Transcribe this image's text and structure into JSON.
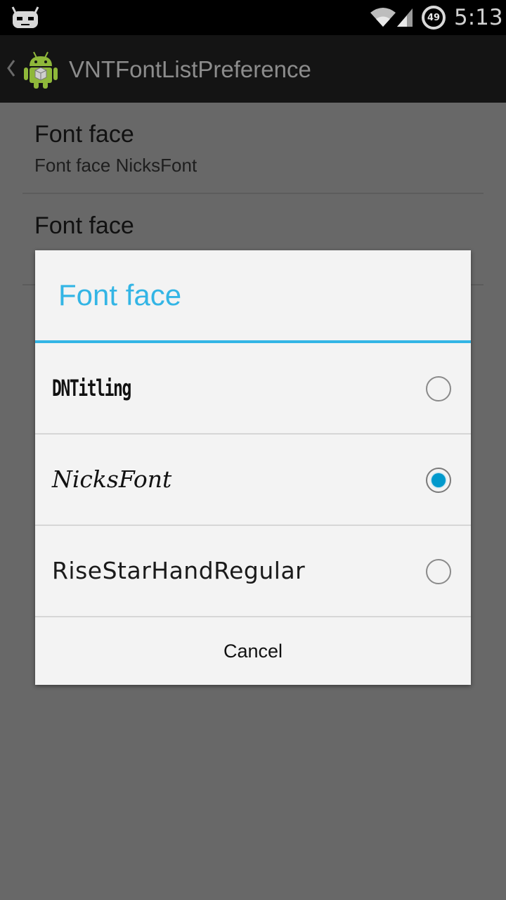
{
  "status_bar": {
    "left_icon": "cyanogenmod-bugdroid-icon",
    "wifi_icon": "wifi-icon",
    "signal_icon": "cell-signal-icon",
    "battery_level": "49",
    "time": "5:13"
  },
  "action_bar": {
    "back_icon": "chevron-left-icon",
    "app_icon": "android-robot-icon",
    "title": "VNTFontListPreference"
  },
  "preferences": [
    {
      "title": "Font face",
      "summary": "Font face NicksFont"
    },
    {
      "title": "Font face",
      "summary": ""
    }
  ],
  "dialog": {
    "title": "Font face",
    "options": [
      {
        "label": "DNTitling",
        "selected": false
      },
      {
        "label": "NicksFont",
        "selected": true
      },
      {
        "label": "RiseStarHandRegular",
        "selected": false
      }
    ],
    "cancel_label": "Cancel"
  },
  "colors": {
    "accent": "#33b5e5",
    "radio_fill": "#0099cc",
    "dim_background": "#686868",
    "action_bar": "#141414"
  }
}
